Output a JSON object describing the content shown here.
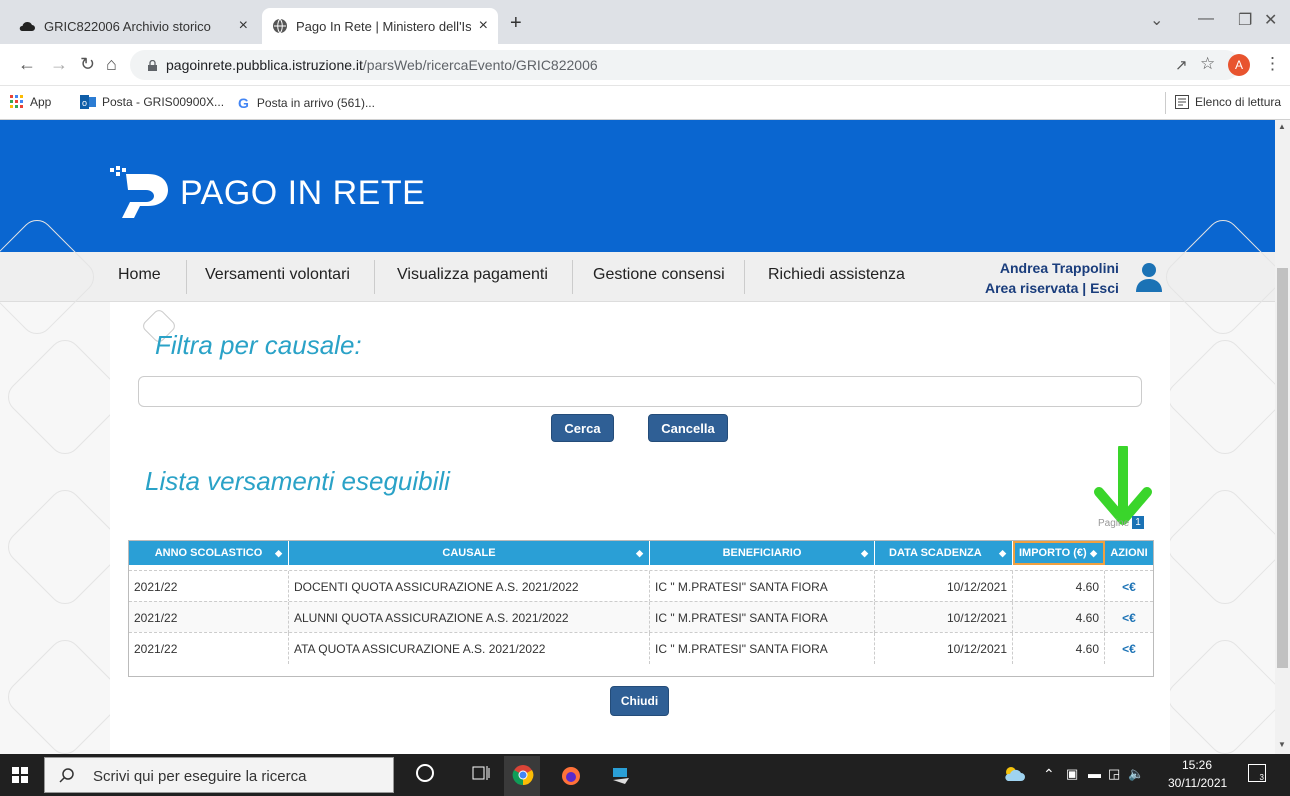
{
  "browser": {
    "tabs": [
      {
        "title": "GRIC822006 Archivio storico",
        "close": "×"
      },
      {
        "title": "Pago In Rete | Ministero dell'Istru",
        "close": "×"
      }
    ],
    "new_tab": "+",
    "url_host": "pagoinrete.pubblica.istruzione.it",
    "url_path": "/parsWeb/ricercaEvento/GRIC822006",
    "profile_initial": "A",
    "bookmarks": [
      "App",
      "Posta - GRIS00900X...",
      "Posta in arrivo (561)..."
    ],
    "reading_list": "Elenco di lettura"
  },
  "site": {
    "logo": "PAGO IN RETE",
    "menu": [
      "Home",
      "Versamenti volontari",
      "Visualizza pagamenti",
      "Gestione consensi",
      "Richiedi assistenza"
    ],
    "user_name": "Andrea Trappolini",
    "user_links": "Area riservata | Esci"
  },
  "filter": {
    "title": "Filtra per causale:",
    "input_value": "",
    "search_button": "Cerca",
    "clear_button": "Cancella"
  },
  "list": {
    "title": "Lista versamenti eseguibili",
    "pages_label": "Pagine",
    "page_number": "1",
    "columns": [
      "ANNO SCOLASTICO",
      "CAUSALE",
      "BENEFICIARIO",
      "DATA SCADENZA",
      "IMPORTO (€)",
      "AZIONI"
    ],
    "rows": [
      {
        "anno": "2021/22",
        "causale": "DOCENTI QUOTA ASSICURAZIONE A.S. 2021/2022",
        "beneficiario": "IC \" M.PRATESI\" SANTA FIORA",
        "scadenza": "10/12/2021",
        "importo": "4.60",
        "azione": "<€"
      },
      {
        "anno": "2021/22",
        "causale": "ALUNNI QUOTA ASSICURAZIONE A.S. 2021/2022",
        "beneficiario": "IC \" M.PRATESI\" SANTA FIORA",
        "scadenza": "10/12/2021",
        "importo": "4.60",
        "azione": "<€"
      },
      {
        "anno": "2021/22",
        "causale": "ATA QUOTA ASSICURAZIONE A.S. 2021/2022",
        "beneficiario": "IC \" M.PRATESI\" SANTA FIORA",
        "scadenza": "10/12/2021",
        "importo": "4.60",
        "azione": "<€"
      }
    ],
    "close_button": "Chiudi"
  },
  "taskbar": {
    "search_placeholder": "Scrivi qui per eseguire la ricerca",
    "time": "15:26",
    "date": "30/11/2021",
    "notifications": "3"
  },
  "colors": {
    "brand_blue": "#0a66d0",
    "table_header": "#2a9fd6",
    "button": "#2f5f95",
    "arrow": "#3ad52b"
  }
}
